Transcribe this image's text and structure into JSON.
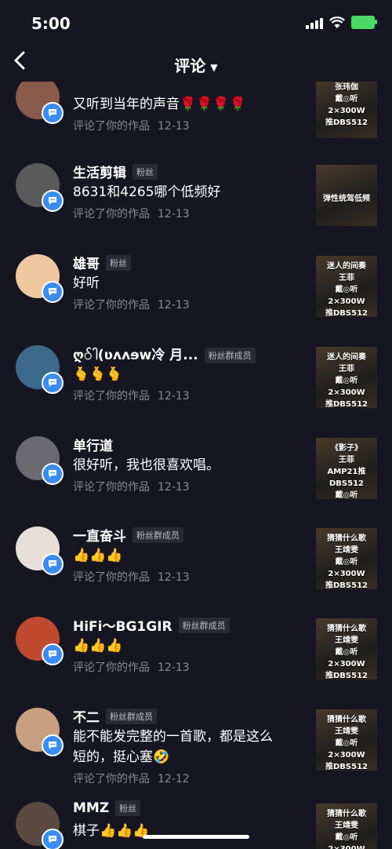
{
  "status": {
    "time": "5:00"
  },
  "header": {
    "title": "评论",
    "back": "<"
  },
  "meta_label": "评论了你的作品",
  "comments": [
    {
      "name": "",
      "tag": "",
      "text": "又听到当年的声音🌹🌹🌹🌹",
      "date": "12-13",
      "thumb": "张玮伽\n戴◎听\n2×300W\n推DBS512",
      "avatar_color": "#8a5a4a"
    },
    {
      "name": "生活剪辑",
      "tag": "粉丝",
      "text": "8631和4265哪个低频好",
      "date": "12-13",
      "thumb": "\n\n弹性统驾低频",
      "avatar_color": "#5a5a5a"
    },
    {
      "name": "雄哥",
      "tag": "粉丝",
      "text": "好听",
      "date": "12-13",
      "thumb": "迷人的间奏\n王菲\n戴◎听\n2×300W\n推DBS512",
      "avatar_color": "#f0c8a0"
    },
    {
      "name": "ღ်ါ(ʋʌʌɘw冷 月...",
      "tag": "粉丝群成员",
      "text": "🫰🫰🫰",
      "date": "12-13",
      "thumb": "迷人的间奏\n王菲\n戴◎听\n2×300W\n推DBS512",
      "avatar_color": "#3c6a8a"
    },
    {
      "name": "单行道",
      "tag": "",
      "text": "很好听，我也很喜欢唱。",
      "date": "12-13",
      "thumb": "《影子》\n王菲\nAMP21推\nDBS512\n戴◎听",
      "avatar_color": "#6a6a70"
    },
    {
      "name": "一直奋斗",
      "tag": "粉丝群成员",
      "text": "👍👍👍",
      "date": "12-13",
      "thumb": "猜猜什么歌\n王靖雯\n戴◎听\n2×300W\n推DBS512",
      "avatar_color": "#e8e0d8"
    },
    {
      "name": "HiFi～BG1GIR",
      "tag": "粉丝群成员",
      "text": "👍👍👍",
      "date": "12-13",
      "thumb": "猜猜什么歌\n王靖雯\n戴◎听\n2×300W\n推DBS512",
      "avatar_color": "#c04a30"
    },
    {
      "name": "不二",
      "tag": "粉丝群成员",
      "text": "能不能发完整的一首歌，都是这么短的，挺心塞🤣",
      "date": "12-12",
      "thumb": "猜猜什么歌\n王靖雯\n戴◎听\n2×300W\n推DBS512",
      "avatar_color": "#c8a080"
    },
    {
      "name": "MMZ",
      "tag": "粉丝",
      "text": "棋子👍👍👍",
      "date": "",
      "thumb": "猜猜什么歌\n王靖雯\n戴◎听\n2×300W\n推DBS512",
      "avatar_color": "#5a4a40"
    }
  ]
}
